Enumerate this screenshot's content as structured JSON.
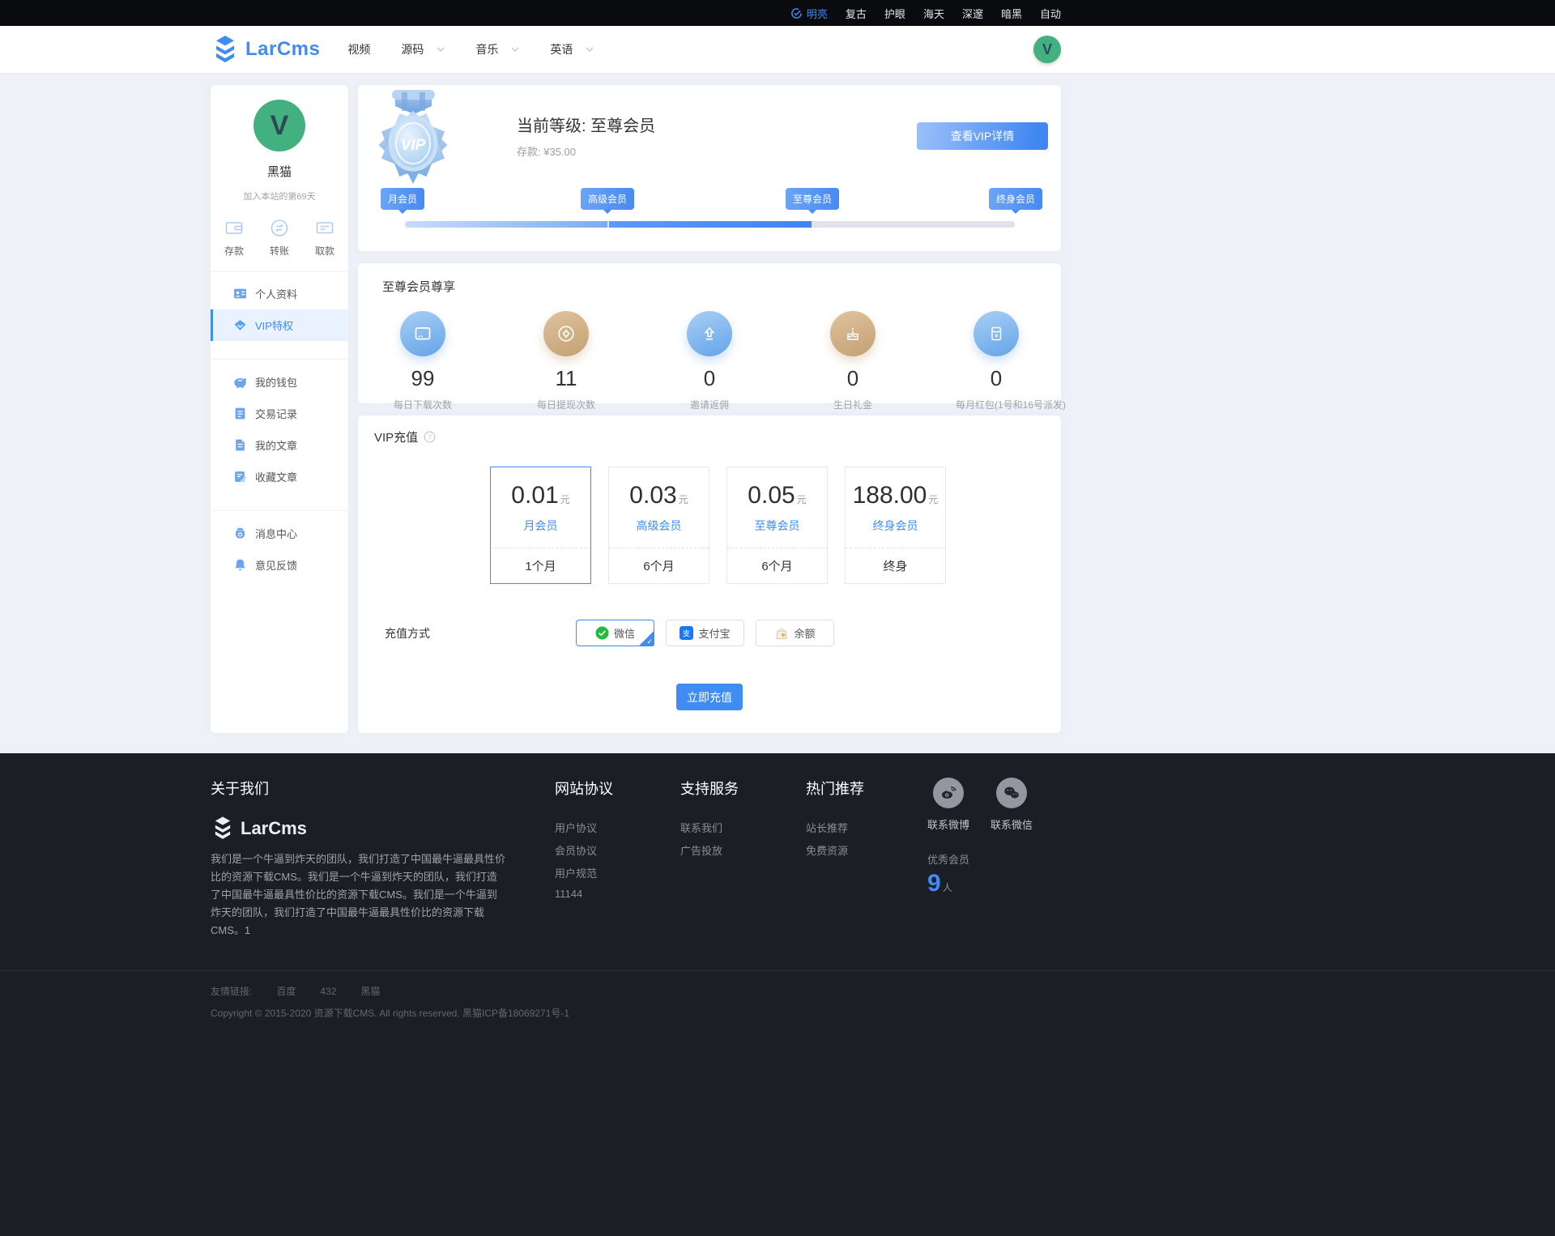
{
  "theme_bar": {
    "items": [
      "明亮",
      "复古",
      "护眼",
      "海天",
      "深邃",
      "暗黑",
      "自动"
    ]
  },
  "header": {
    "logo_text": "LarCms",
    "nav": [
      {
        "label": "视频"
      },
      {
        "label": "源码"
      },
      {
        "label": "音乐"
      },
      {
        "label": "英语"
      }
    ],
    "avatar_letter": "V"
  },
  "sidebar": {
    "avatar_letter": "V",
    "username": "黑猫",
    "join_text": "加入本站的第69天",
    "quick_actions": [
      {
        "label": "存款"
      },
      {
        "label": "转账"
      },
      {
        "label": "取款"
      }
    ],
    "menu": [
      {
        "label": "个人资料"
      },
      {
        "label": "VIP特权"
      },
      {
        "label": "我的钱包"
      },
      {
        "label": "交易记录"
      },
      {
        "label": "我的文章"
      },
      {
        "label": "收藏文章"
      },
      {
        "label": "消息中心"
      },
      {
        "label": "意见反馈"
      }
    ]
  },
  "vip_status": {
    "medal_text": "VIP",
    "title": "当前等级: 至尊会员",
    "balance_label": "存款:",
    "balance_value": "¥35.00",
    "detail_button": "查看VIP详情",
    "levels": [
      {
        "label": "月会员"
      },
      {
        "label": "高级会员"
      },
      {
        "label": "至尊会员"
      },
      {
        "label": "终身会员"
      }
    ],
    "progress_percent": 67
  },
  "benefits": {
    "title": "至尊会员尊享",
    "items": [
      {
        "value": "99",
        "label": "每日下载次数"
      },
      {
        "value": "11",
        "label": "每日提现次数"
      },
      {
        "value": "0",
        "label": "邀请返佣"
      },
      {
        "value": "0",
        "label": "生日礼金"
      },
      {
        "value": "0",
        "label": "每月红包(1号和16号派发)"
      }
    ]
  },
  "recharge": {
    "title": "VIP充值",
    "plans": [
      {
        "price": "0.01",
        "unit": "元",
        "name": "月会员",
        "duration": "1个月"
      },
      {
        "price": "0.03",
        "unit": "元",
        "name": "高级会员",
        "duration": "6个月"
      },
      {
        "price": "0.05",
        "unit": "元",
        "name": "至尊会员",
        "duration": "6个月"
      },
      {
        "price": "188.00",
        "unit": "元",
        "name": "终身会员",
        "duration": "终身"
      }
    ],
    "selected_plan_index": 0,
    "method_label": "充值方式",
    "methods": [
      {
        "name": "微信"
      },
      {
        "name": "支付宝"
      },
      {
        "name": "余额"
      }
    ],
    "selected_method_index": 0,
    "submit_button": "立即充值"
  },
  "footer": {
    "about_title": "关于我们",
    "logo_text": "LarCms",
    "about_text": "我们是一个牛逼到炸天的团队，我们打造了中国最牛逼最具性价比的资源下载CMS。我们是一个牛逼到炸天的团队，我们打造了中国最牛逼最具性价比的资源下载CMS。我们是一个牛逼到炸天的团队，我们打造了中国最牛逼最具性价比的资源下载CMS。1",
    "columns": [
      {
        "title": "网站协议",
        "links": [
          "用户协议",
          "会员协议",
          "用户规范",
          "11144"
        ]
      },
      {
        "title": "支持服务",
        "links": [
          "联系我们",
          "广告投放"
        ]
      },
      {
        "title": "热门推荐",
        "links": [
          "站长推荐",
          "免费资源"
        ]
      }
    ],
    "socials": [
      {
        "label": "联系微博"
      },
      {
        "label": "联系微信"
      }
    ],
    "members_label": "优秀会员",
    "members_count": "9",
    "members_unit": "人",
    "friend_links_label": "友情链接:",
    "friend_links": [
      "百度",
      "432",
      "黑猫"
    ],
    "copyright": "Copyright © 2015-2020 资源下载CMS. All rights reserved. 黑猫ICP备18069271号-1"
  }
}
